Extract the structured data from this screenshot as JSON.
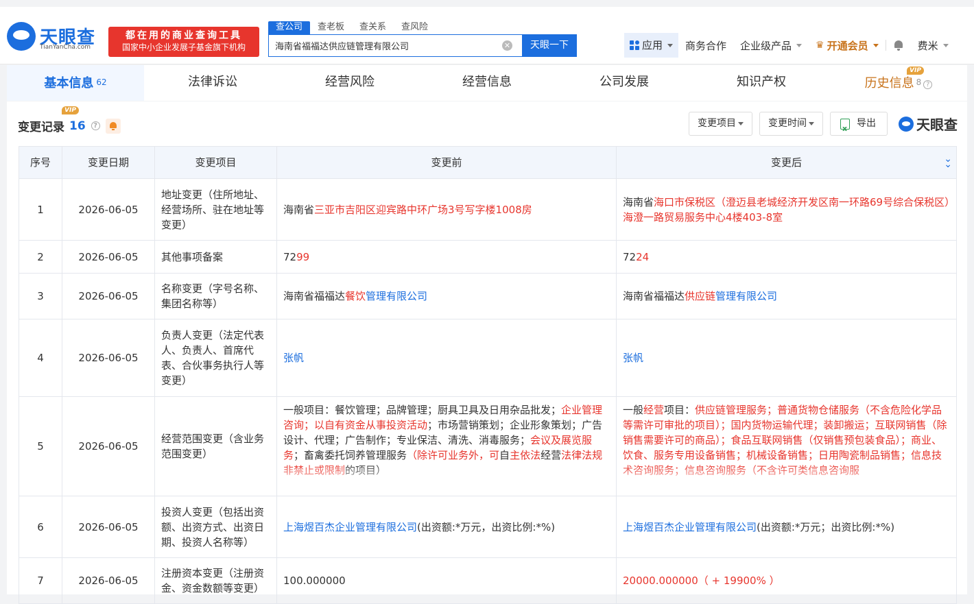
{
  "header": {
    "logo_cn": "天眼查",
    "logo_en": "TianYanCha.com",
    "slogan_1": "都在用的商业查询工具",
    "slogan_2": "国家中小企业发展子基金旗下机构",
    "search_tabs": [
      "查公司",
      "查老板",
      "查关系",
      "查风险"
    ],
    "search_value": "海南省福福达供应链管理有限公司",
    "search_button": "天眼一下",
    "nav": {
      "app": "应用",
      "business": "商务合作",
      "enterprise": "企业级产品",
      "vip": "开通会员",
      "user": "费米"
    }
  },
  "main_tabs": [
    {
      "label": "基本信息",
      "count": "62"
    },
    {
      "label": "法律诉讼"
    },
    {
      "label": "经营风险"
    },
    {
      "label": "经营信息"
    },
    {
      "label": "公司发展"
    },
    {
      "label": "知识产权"
    },
    {
      "label": "历史信息",
      "count": "8",
      "badge": "VIP"
    }
  ],
  "section": {
    "title": "变更记录",
    "count": "16",
    "badge": "VIP",
    "filter_item": "变更项目",
    "filter_time": "变更时间",
    "export": "导出",
    "brand": "天眼查"
  },
  "table": {
    "headers": [
      "序号",
      "变更日期",
      "变更项目",
      "变更前",
      "变更后"
    ],
    "rows": [
      {
        "no": "1",
        "date": "2026-06-05",
        "item": "地址变更（住所地址、经营场所、驻在地址等变更）"
      },
      {
        "no": "2",
        "date": "2026-06-05",
        "item": "其他事项备案"
      },
      {
        "no": "3",
        "date": "2026-06-05",
        "item": "名称变更（字号名称、集团名称等）"
      },
      {
        "no": "4",
        "date": "2026-06-05",
        "item": "负责人变更（法定代表人、负责人、首席代表、合伙事务执行人等变更）"
      },
      {
        "no": "5",
        "date": "2026-06-05",
        "item": "经营范围变更（含业务范围变更）"
      },
      {
        "no": "6",
        "date": "2026-06-05",
        "item": "投资人变更（包括出资额、出资方式、出资日期、投资人名称等）"
      },
      {
        "no": "7",
        "date": "2026-06-05",
        "item": "注册资本变更（注册资金、资金数额等变更）"
      }
    ],
    "r1_before": [
      "海南省",
      "三亚市吉阳区迎宾路中环广场3号写字楼1008房"
    ],
    "r1_after": [
      "海南省",
      "海口市保税区（澄迈县老城经济开发区南一环路69号综合保税区）海澄一路贸易服务中心4楼403-8室"
    ],
    "r2_before": [
      "72",
      "99"
    ],
    "r2_after": [
      "72",
      "24"
    ],
    "r3_before": [
      "海南省福福达",
      "餐饮",
      "管理有限公司"
    ],
    "r3_after": [
      "海南省福福达",
      "供应链",
      "管理有限公司"
    ],
    "r4_before": "张帆",
    "r4_after": "张帆",
    "r5_before": [
      "一般项目：餐饮管理；品牌管理；厨具卫具及日用杂品批发；",
      "企业管理咨询；以自有资金从事投资活动",
      "；市场营销策划；企业形象策划；广告设计、代理；广告制作；专业保洁、清洗、消毒服务；",
      "会议及展览服务",
      "；畜禽委托饲养管理服务",
      "（除许可业务外，可",
      "自",
      "主依法",
      "经营",
      "法律法规非禁止或限制",
      "的项目）"
    ],
    "r5_after": [
      "一般",
      "经营",
      "项目：",
      "供应链管理服务；普通货物仓储服务（不含危险化学品等需许可审批的项目）；国内货物运输代理；装卸搬运；互联网销售（除销售需要许可的商品）；食品互联网销售（仅销售预包装食品）；商业、饮食、服务专用设备销售；机械设备销售；日用陶瓷制品销售；信息技术咨询服务；信息咨询服务（不含许可类信息咨询服"
    ],
    "r6_before": [
      "上海煜百杰企业管理有限公司",
      "(出资额:*万元，出资比例:*%)"
    ],
    "r6_after": [
      "上海煜百杰企业管理有限公司",
      "(出资额:*万元；出资比例:*%)"
    ],
    "r7_before": "100.000000",
    "r7_after": "20000.000000（ + 19900% ）"
  },
  "colors": {
    "brand_blue": "#1c6ede",
    "highlight_red": "#e7352d",
    "vip_orange": "#c8731b"
  }
}
